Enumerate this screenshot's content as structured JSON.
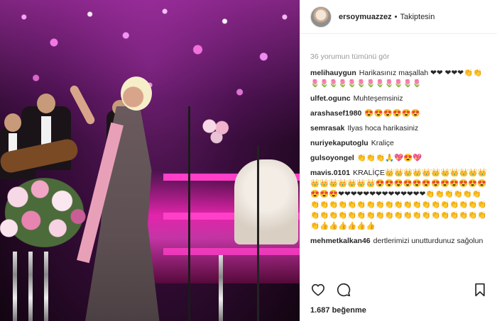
{
  "post": {
    "username": "ersoymuazzez",
    "separator": "•",
    "follow_status": "Takiptesin",
    "view_all_comments": "36 yorumun tümünü gör",
    "likes": "1.687 beğenme"
  },
  "comments": [
    {
      "user": "melihauygun",
      "text": "Harikasınız maşallah ❤❤ ❤❤❤👏👏🌷🌷🌷🌷🌷🌷🌷🌷🌷🌷🌷🌷"
    },
    {
      "user": "ulfet.ogunc",
      "text": "Muhteşemsiniz"
    },
    {
      "user": "arashasef1980",
      "text": "😍😍😍😍😍😍"
    },
    {
      "user": "semrasak",
      "text": "Ilyas hoca harikasiniz"
    },
    {
      "user": "nuriyekaputoglu",
      "text": "Kraliçe"
    },
    {
      "user": "gulsoyongel",
      "text": "👏👏👏🙏💖😍💖"
    },
    {
      "user": "mavis.0101",
      "text": "KRALİÇE👑👑👑👑👑👑👑👑👑👑👑👑👑👑👑👑👑👑😍😍😍😍😍😍😍😍😍😍😍😍😍😍😍❤❤❤❤❤❤❤❤❤❤❤❤❤❤👏👏👏👏👏👏👏👏👏👏👏👏👏👏👏👏👏👏👏👏👏👏👏👏👏👏👏👏👏👏👏👏👏👏👏👏👏👏👏👏👏👏👏👏👏👍👍👍👍👍👍"
    },
    {
      "user": "mehmetkalkan46",
      "text": "dertlerimizi unutturdunuz sağolun"
    }
  ]
}
